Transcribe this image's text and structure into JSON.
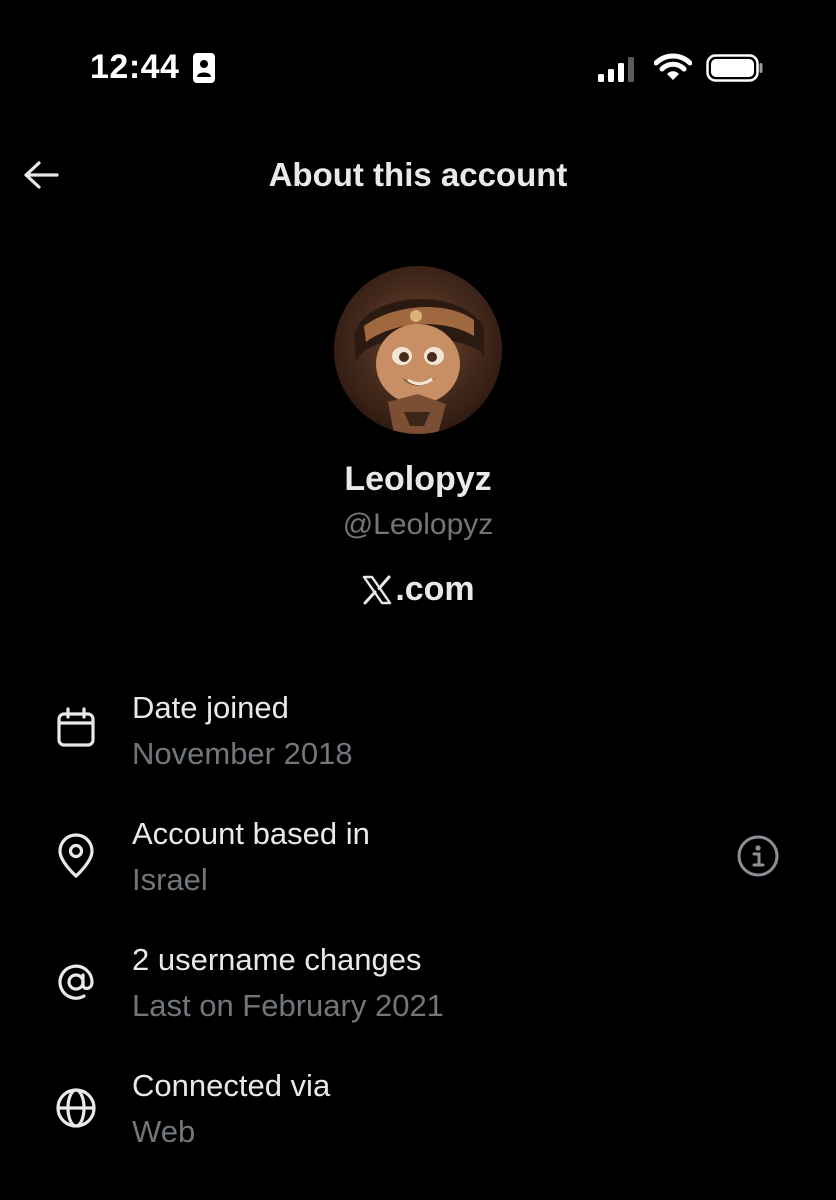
{
  "status_bar": {
    "time": "12:44",
    "icons": [
      "contact-card-icon",
      "cellular-signal-icon",
      "wifi-icon",
      "battery-icon"
    ]
  },
  "header": {
    "title": "About this account",
    "back_icon": "arrow-left-icon"
  },
  "profile": {
    "display_name": "Leolopyz",
    "handle": "@Leolopyz",
    "site_logo": "x-logo-icon",
    "site_label": ".com"
  },
  "info": [
    {
      "icon": "calendar-icon",
      "title": "Date joined",
      "subtitle": "November 2018"
    },
    {
      "icon": "location-pin-icon",
      "title": "Account based in",
      "subtitle": "Israel",
      "trailing_icon": "info-circle-icon"
    },
    {
      "icon": "at-sign-icon",
      "title": "2 username changes",
      "subtitle": "Last on February 2021"
    },
    {
      "icon": "globe-icon",
      "title": "Connected via",
      "subtitle": "Web"
    }
  ],
  "colors": {
    "background": "#000000",
    "primary_text": "#e7e9ea",
    "secondary_text": "#71767b"
  }
}
